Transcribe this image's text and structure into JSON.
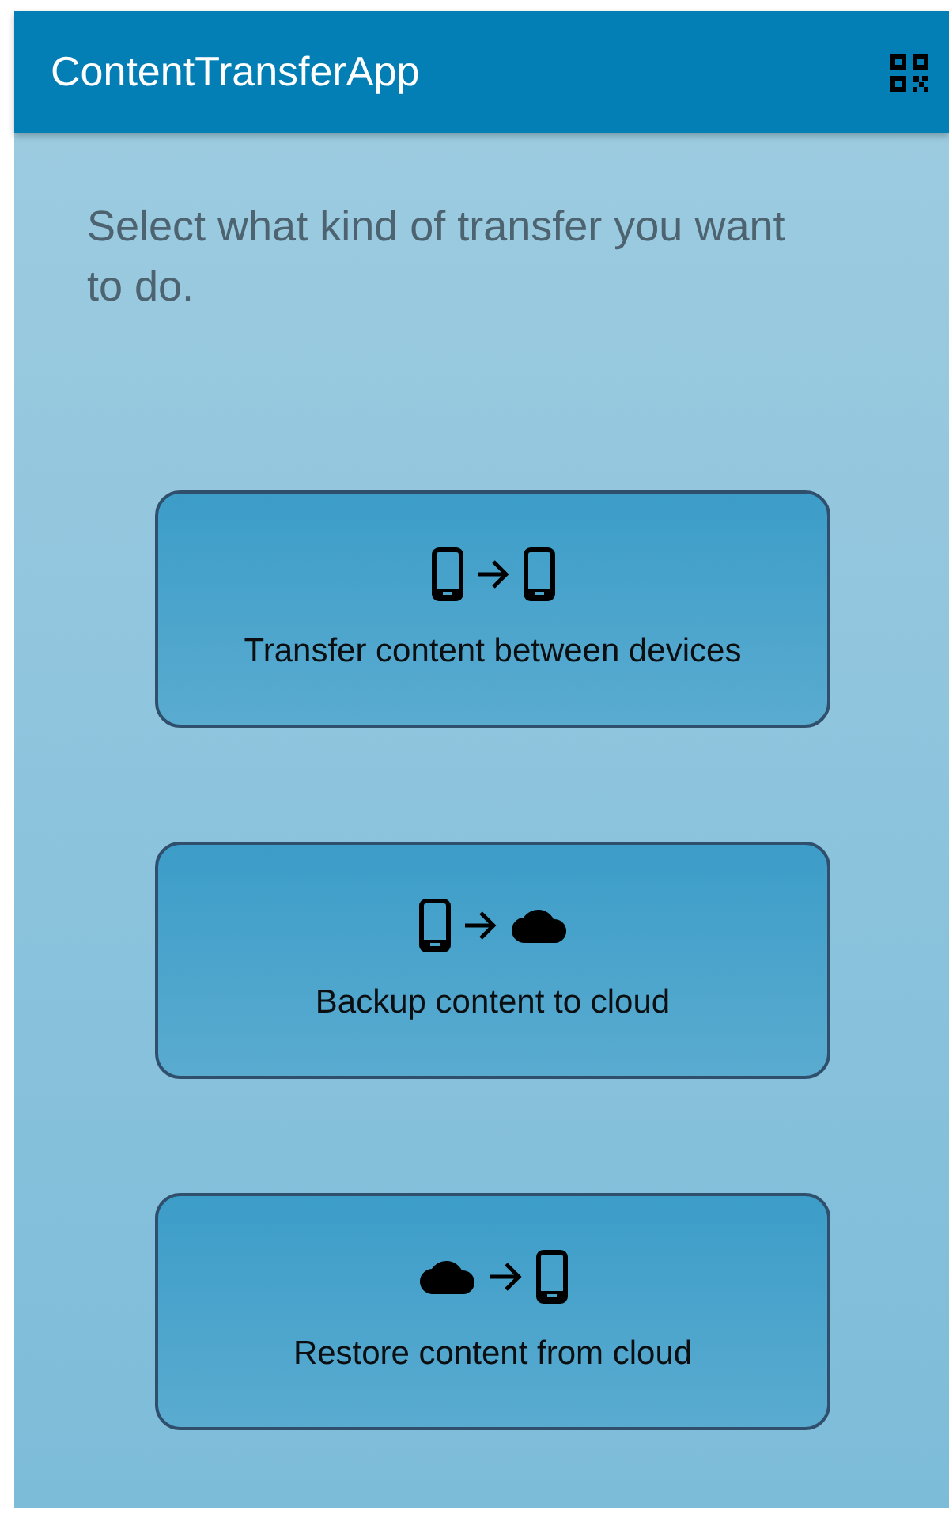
{
  "app_bar": {
    "title": "ContentTransferApp"
  },
  "prompt": "Select what kind of transfer you want to do.",
  "options": [
    {
      "label": "Transfer content between devices",
      "icons": [
        {
          "kind": "phone"
        },
        {
          "kind": "arrow"
        },
        {
          "kind": "phone"
        }
      ]
    },
    {
      "label": "Backup content to cloud",
      "icons": [
        {
          "kind": "phone"
        },
        {
          "kind": "arrow"
        },
        {
          "kind": "cloud"
        }
      ]
    },
    {
      "label": "Restore content from cloud",
      "icons": [
        {
          "kind": "cloud"
        },
        {
          "kind": "arrow"
        },
        {
          "kind": "phone"
        }
      ]
    }
  ]
}
